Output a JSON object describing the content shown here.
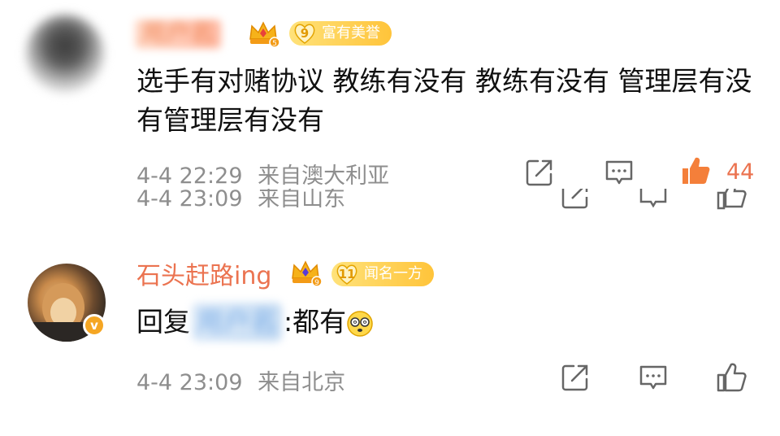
{
  "comments": [
    {
      "username": "用户名",
      "crown_level": "5",
      "badge": {
        "level": "9",
        "label": "富有美誉"
      },
      "text": "选手有对赌协议 教练有没有 教练有没有 管理层有没有管理层有没有",
      "time": "4-4 22:29",
      "location": "来自澳大利亚",
      "likes": "44",
      "liked": true
    },
    {
      "partial_time": "4-4 23:09",
      "partial_location": "来自山东"
    },
    {
      "username": "石头赶路ing",
      "crown_level": "9",
      "badge": {
        "level": "11",
        "label": "闻名一方"
      },
      "reply_prefix": "回复",
      "reply_target": "用户名",
      "reply_text": ":都有",
      "time": "4-4 23:09",
      "location": "来自北京",
      "verified_icon": "v"
    }
  ],
  "colors": {
    "accent": "#eb7350",
    "meta": "#8e8e8e",
    "badge": "#ffc43a"
  }
}
